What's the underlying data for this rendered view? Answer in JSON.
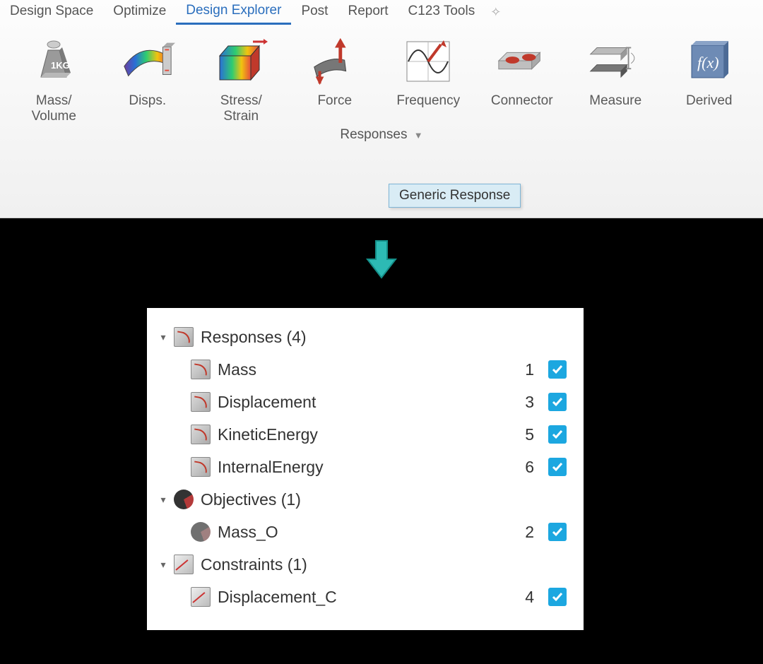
{
  "tabs": [
    "Design Space",
    "Optimize",
    "Design Explorer",
    "Post",
    "Report",
    "C123 Tools"
  ],
  "active_tab": 2,
  "tools": [
    {
      "label": "Mass/\nVolume",
      "name": "mass-volume"
    },
    {
      "label": "Disps.",
      "name": "disps"
    },
    {
      "label": "Stress/\nStrain",
      "name": "stress-strain"
    },
    {
      "label": "Force",
      "name": "force"
    },
    {
      "label": "Frequency",
      "name": "frequency"
    },
    {
      "label": "Connector",
      "name": "connector"
    },
    {
      "label": "Measure",
      "name": "measure"
    },
    {
      "label": "Derived",
      "name": "derived"
    }
  ],
  "group_label": "Responses",
  "tooltip": "Generic Response",
  "tree": {
    "responses": {
      "label": "Responses (4)",
      "items": [
        {
          "label": "Mass",
          "num": "1",
          "checked": true
        },
        {
          "label": "Displacement",
          "num": "3",
          "checked": true
        },
        {
          "label": "KineticEnergy",
          "num": "5",
          "checked": true
        },
        {
          "label": "InternalEnergy",
          "num": "6",
          "checked": true
        }
      ]
    },
    "objectives": {
      "label": "Objectives (1)",
      "items": [
        {
          "label": "Mass_O",
          "num": "2",
          "checked": true
        }
      ]
    },
    "constraints": {
      "label": "Constraints (1)",
      "items": [
        {
          "label": "Displacement_C",
          "num": "4",
          "checked": true
        }
      ]
    }
  }
}
